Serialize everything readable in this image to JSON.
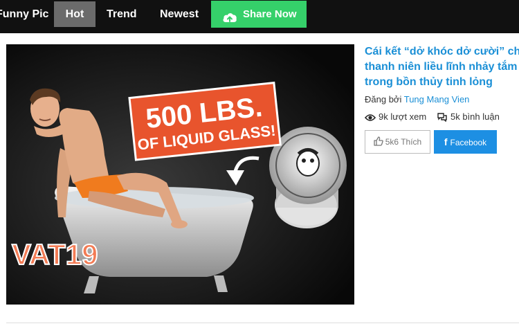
{
  "nav": {
    "items": [
      {
        "label": "Funny Pic"
      },
      {
        "label": "Hot",
        "active": true
      },
      {
        "label": "Trend"
      },
      {
        "label": "Newest"
      }
    ],
    "share_label": "Share Now",
    "share_icon": "cloud-upload-icon",
    "colors": {
      "bar": "#111111",
      "active": "#6b6b6b",
      "share": "#35d06a"
    }
  },
  "post": {
    "title_lines": [
      "Cái kết “dở khóc dở cười” cho",
      "thanh niên liều lĩnh nhảy tắm",
      "trong bồn thủy tinh lỏng"
    ],
    "posted_by_label": "Đăng bởi",
    "author": "Tung Mang Vien",
    "views": "9k lượt xem",
    "comments": "5k bình luận",
    "like_label": "5k6 Thích",
    "facebook_label": "Facebook",
    "image": {
      "headline_line1": "500 LBS.",
      "headline_line2": "OF LIQUID GLASS!",
      "brand": "VAT19"
    },
    "colors": {
      "title": "#1a8fd6",
      "facebook": "#1d8fe3",
      "banner": "#e8542d"
    }
  }
}
